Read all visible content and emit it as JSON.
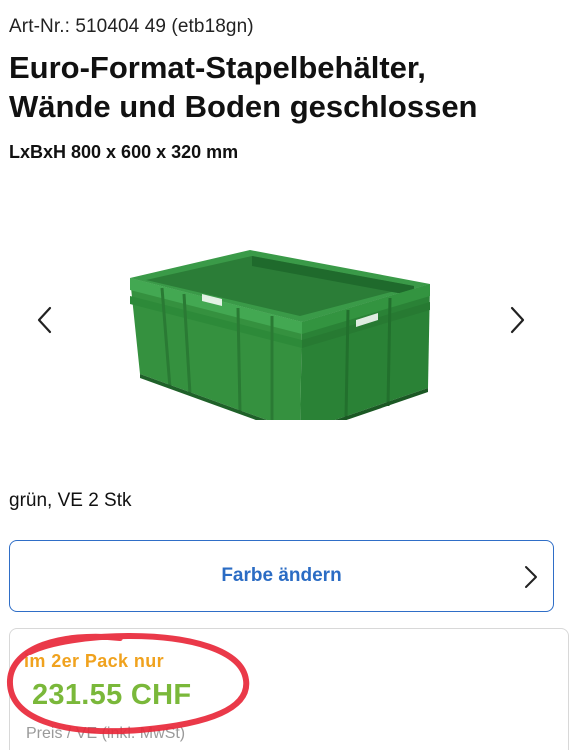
{
  "product": {
    "art_nr": "Art-Nr.: 510404 49 (etb18gn)",
    "title_line1": "Euro-Format-Stapelbehälter,",
    "title_line2": "Wände und Boden geschlossen",
    "dimensions": "LxBxH 800 x 600 x 320 mm",
    "variant": "grün, VE 2 Stk"
  },
  "gallery": {
    "prev_icon": "chevron-left-icon",
    "next_icon": "chevron-right-icon",
    "image": "green-stacking-container",
    "image_color": "#2e8a3e"
  },
  "color_button": {
    "label": "Farbe ändern",
    "icon": "chevron-right-icon",
    "accent": "#2b6cc4"
  },
  "pricing": {
    "pack_note": "im 2er Pack nur",
    "price": "231.55 CHF",
    "price_sub": "Preis / VE (inkl. MwSt)",
    "pack_note_color": "#f0a21e",
    "price_color": "#7ab83a",
    "annotation_color": "#e8283a"
  }
}
